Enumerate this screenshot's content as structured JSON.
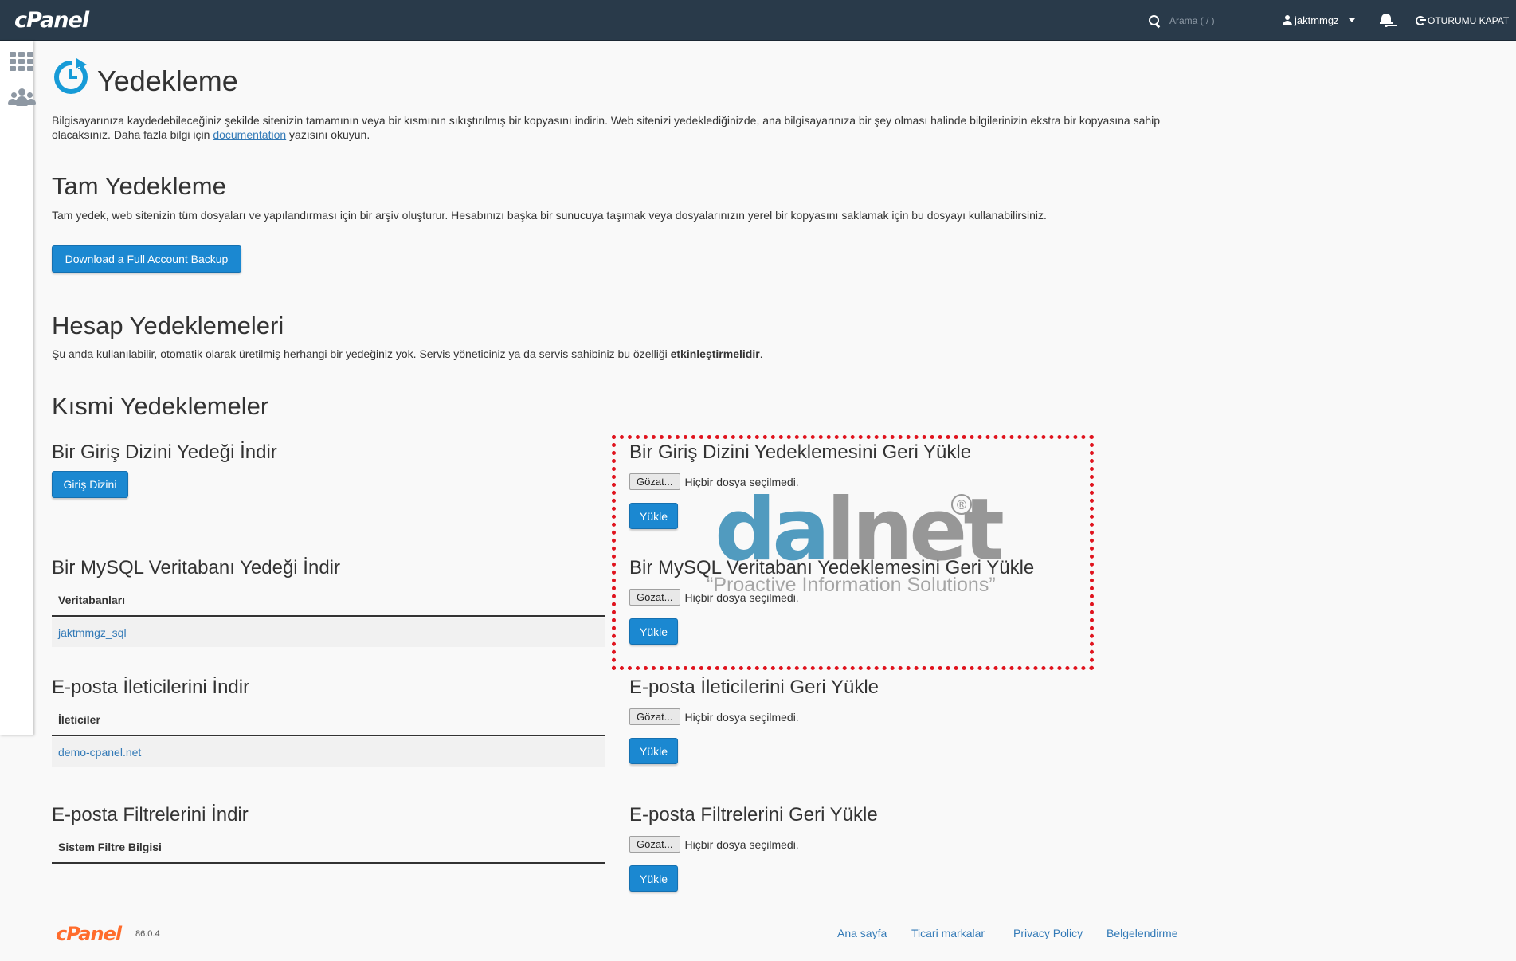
{
  "topbar": {
    "logo": "cPanel",
    "search_placeholder": "Arama ( / )",
    "username": "jaktmmgz",
    "logout": "OTURUMU KAPAT"
  },
  "sidebar": {
    "icons": [
      "grid-icon",
      "users-icon"
    ]
  },
  "page": {
    "title": "Yedekleme",
    "intro_part1": "Bilgisayarınıza kaydedebileceğiniz şekilde sitenizin tamamının veya bir kısmının sıkıştırılmış bir kopyasını indirin. Web sitenizi yedeklediğinizde, ana bilgisayarınıza bir şey olması halinde bilgilerinizin ekstra bir kopyasına sahip olacaksınız. Daha fazla bilgi için ",
    "intro_link": "documentation",
    "intro_part2": " yazısını okuyun."
  },
  "full_backup": {
    "title": "Tam Yedekleme",
    "description": "Tam yedek, web sitenizin tüm dosyaları ve yapılandırması için bir arşiv oluşturur. Hesabınızı başka bir sunucuya taşımak veya dosyalarınızın yerel bir kopyasını saklamak için bu dosyayı kullanabilirsiniz.",
    "button": "Download a Full Account Backup"
  },
  "account_backups": {
    "title": "Hesap Yedeklemeleri",
    "description_part1": "Şu anda kullanılabilir, otomatik olarak üretilmiş herhangi bir yedeğiniz yok. Servis yöneticiniz ya da servis sahibiniz bu özelliği ",
    "description_bold": "etkinleştirmelidir",
    "description_part2": "."
  },
  "partial": {
    "title": "Kısmi Yedeklemeler",
    "home_download": {
      "title": "Bir Giriş Dizini Yedeği İndir",
      "button": "Giriş Dizini"
    },
    "mysql_download": {
      "title": "Bir MySQL Veritabanı Yedeği İndir",
      "column": "Veritabanları",
      "rows": [
        "jaktmmgz_sql"
      ]
    },
    "email_download": {
      "title": "E-posta İleticilerini İndir",
      "column": "İleticiler",
      "rows": [
        "demo-cpanel.net"
      ]
    },
    "filters_download": {
      "title": "E-posta Filtrelerini İndir",
      "column": "Sistem Filtre Bilgisi"
    },
    "home_restore": {
      "title": "Bir Giriş Dizini Yedeklemesini Geri Yükle",
      "browse": "Gözat...",
      "no_file": "Hiçbir dosya seçilmedi.",
      "button": "Yükle"
    },
    "mysql_restore": {
      "title": "Bir MySQL Veritabanı Yedeklemesini Geri Yükle",
      "browse": "Gözat...",
      "no_file": "Hiçbir dosya seçilmedi.",
      "button": "Yükle"
    },
    "email_restore": {
      "title": "E-posta İleticilerini Geri Yükle",
      "browse": "Gözat...",
      "no_file": "Hiçbir dosya seçilmedi.",
      "button": "Yükle"
    },
    "filters_restore": {
      "title": "E-posta Filtrelerini Geri Yükle",
      "browse": "Gözat...",
      "no_file": "Hiçbir dosya seçilmedi.",
      "button": "Yükle"
    }
  },
  "watermark": {
    "brand_d": "da",
    "brand_rest": "lnet",
    "registered": "®",
    "tagline": "“Proactive Information Solutions”"
  },
  "footer": {
    "logo": "cPanel",
    "version": "86.0.4",
    "links": [
      "Ana sayfa",
      "Ticari markalar",
      "Privacy Policy",
      "Belgelendirme"
    ]
  },
  "colors": {
    "navbar": "#293a4a",
    "button": "#1b88d1",
    "link": "#337ab7",
    "highlight": "#e0141e",
    "footer_logo": "#ff6c2c"
  }
}
